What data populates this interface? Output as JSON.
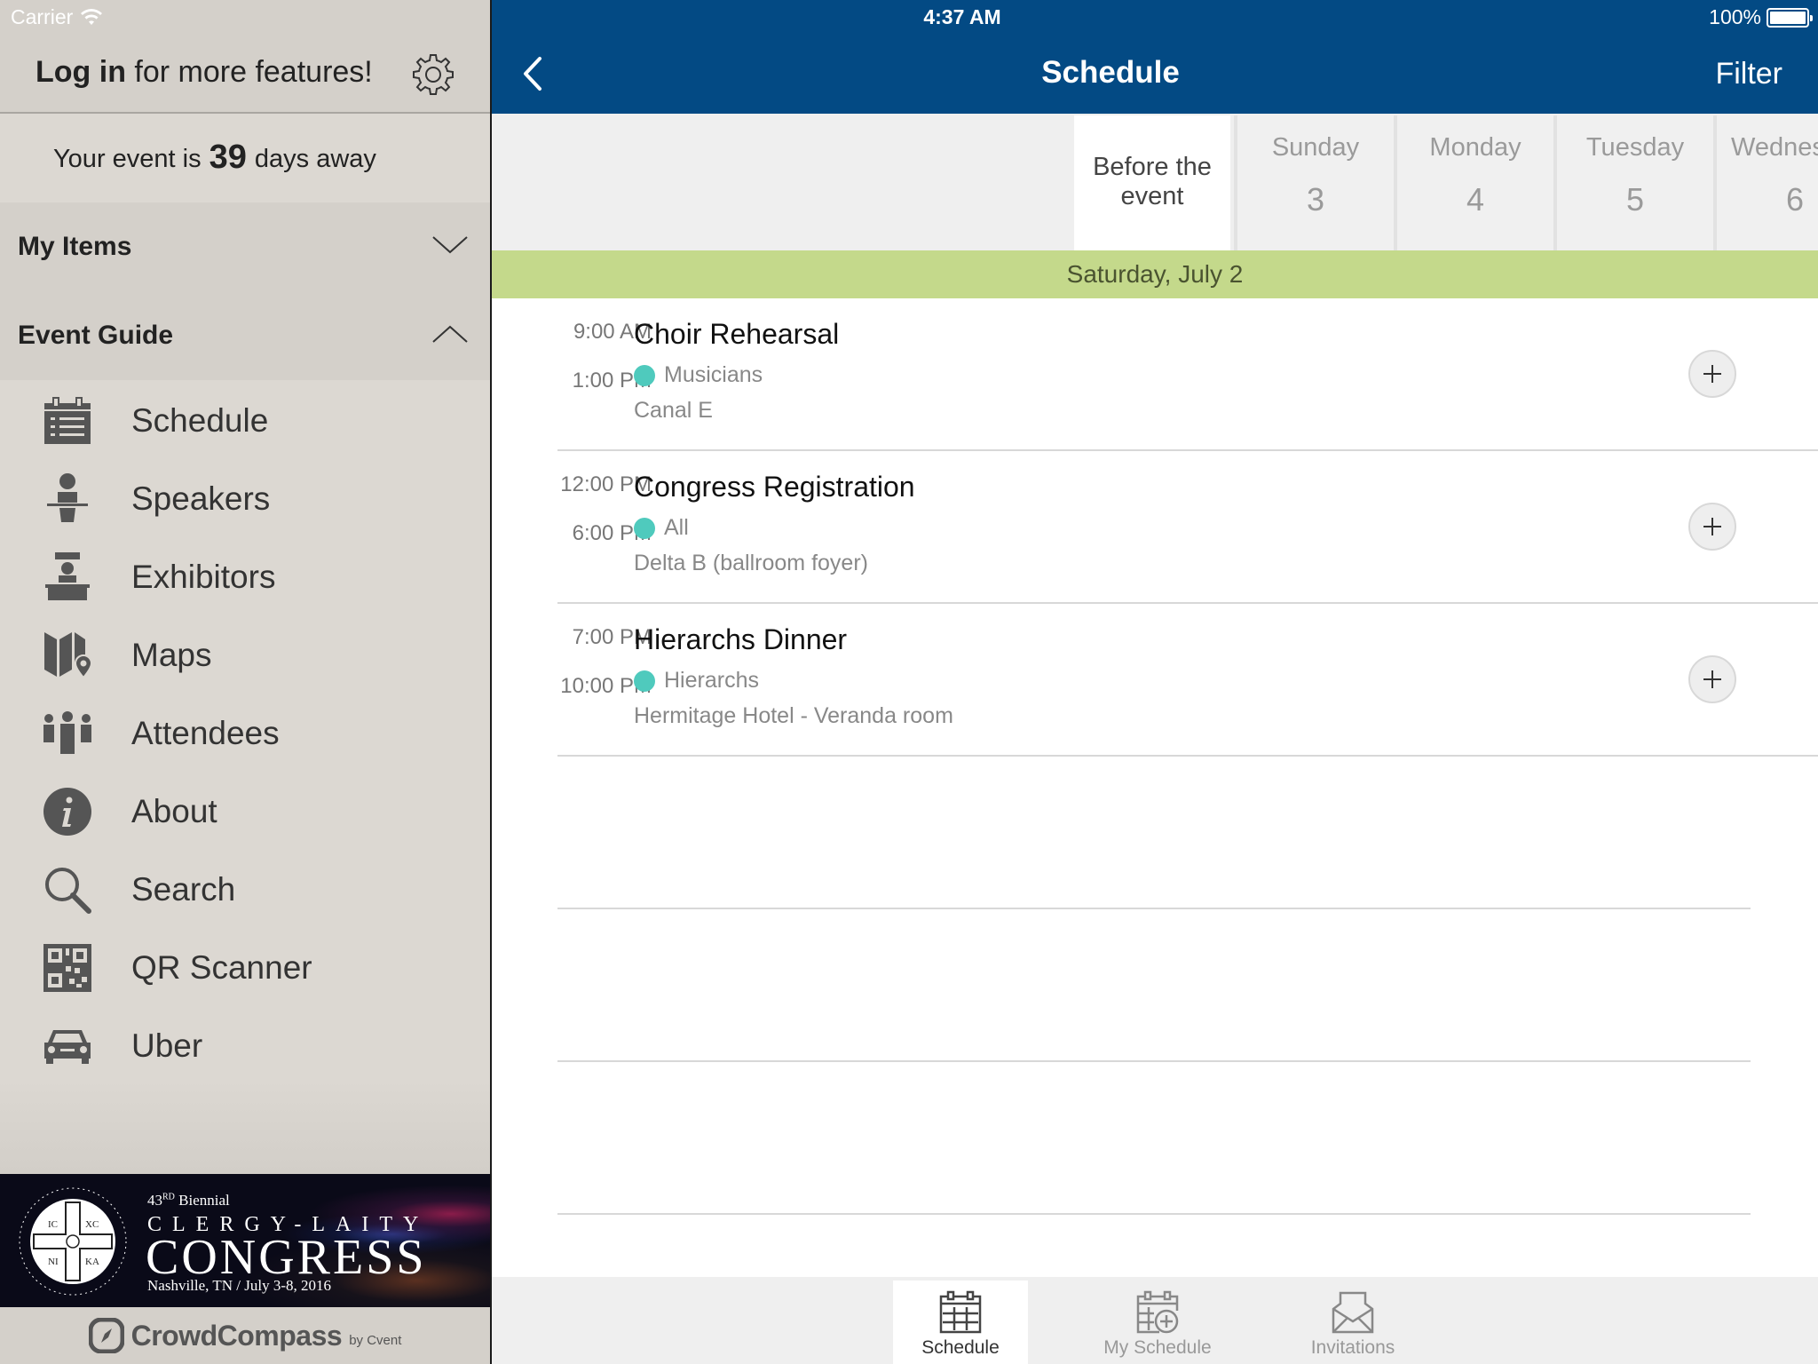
{
  "status_bar": {
    "carrier": "Carrier",
    "time": "4:37 AM",
    "battery_text": "100%",
    "battery_level": 1.0
  },
  "sidebar": {
    "login_bold": "Log in",
    "login_rest": " for more features!",
    "countdown_prefix": "Your event is",
    "countdown_days": "39",
    "countdown_suffix": "days away",
    "sections": [
      {
        "label": "My Items",
        "state": "collapsed",
        "icon": "chevron-down-icon"
      },
      {
        "label": "Event Guide",
        "state": "expanded",
        "icon": "chevron-up-icon"
      }
    ],
    "items": [
      {
        "label": "Schedule",
        "icon": "schedule-icon"
      },
      {
        "label": "Speakers",
        "icon": "speakers-icon"
      },
      {
        "label": "Exhibitors",
        "icon": "exhibitors-icon"
      },
      {
        "label": "Maps",
        "icon": "maps-icon"
      },
      {
        "label": "Attendees",
        "icon": "attendees-icon"
      },
      {
        "label": "About",
        "icon": "info-icon"
      },
      {
        "label": "Search",
        "icon": "search-icon"
      },
      {
        "label": "QR Scanner",
        "icon": "qr-code-icon"
      },
      {
        "label": "Uber",
        "icon": "car-icon"
      }
    ],
    "banner": {
      "edition_num": "43",
      "edition_sup": "RD",
      "edition_word": "Biennial",
      "line1": "CLERGY-LAITY",
      "line2": "CONGRESS",
      "location": "Nashville, TN / July 3-8, 2016",
      "seal_labels": [
        "IC",
        "XC",
        "NI",
        "KA"
      ]
    },
    "footer": {
      "brand": "CrowdCompass",
      "by": "by Cvent"
    }
  },
  "header": {
    "title": "Schedule",
    "filter_label": "Filter"
  },
  "day_tabs": [
    {
      "label": "Before the event",
      "active": true
    },
    {
      "day": "Sunday",
      "num": "3"
    },
    {
      "day": "Monday",
      "num": "4"
    },
    {
      "day": "Tuesday",
      "num": "5"
    },
    {
      "day": "Wednes",
      "num": "6"
    }
  ],
  "date_header": "Saturday, July 2",
  "sessions": [
    {
      "start": "9:00 AM",
      "end": "1:00 PM",
      "title": "Choir Rehearsal",
      "track": "Musicians",
      "location": "Canal E",
      "track_color": "#4fcabd"
    },
    {
      "start": "12:00 PM",
      "end": "6:00 PM",
      "title": "Congress Registration",
      "track": "All",
      "location": "Delta B (ballroom foyer)",
      "track_color": "#4fcabd"
    },
    {
      "start": "7:00 PM",
      "end": "10:00 PM",
      "title": "Hierarchs Dinner",
      "track": "Hierarchs",
      "location": "Hermitage Hotel - Veranda room",
      "track_color": "#4fcabd"
    }
  ],
  "tab_bar": [
    {
      "label": "Schedule",
      "active": true
    },
    {
      "label": "My Schedule",
      "active": false
    },
    {
      "label": "Invitations",
      "active": false
    }
  ],
  "colors": {
    "nav_blue": "#034a84",
    "date_band_green": "#c4d98b",
    "track_teal": "#4fcabd",
    "sidebar_bg": "#dcd8d2"
  }
}
